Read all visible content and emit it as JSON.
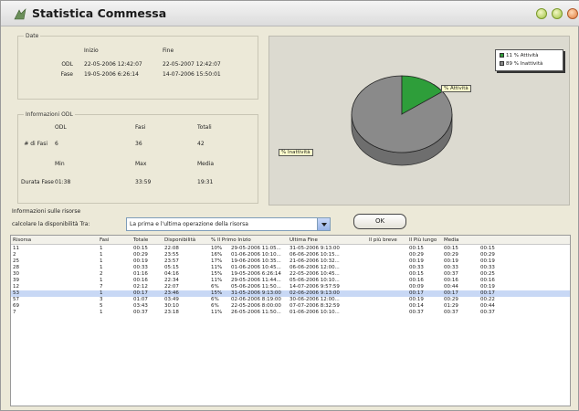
{
  "window": {
    "title": "Statistica Commessa"
  },
  "date_group": {
    "label": "Date",
    "col_start": "Inizio",
    "col_end": "Fine",
    "rows": [
      {
        "label": "ODL",
        "start": "22-05-2006 12:42:07",
        "end": "22-05-2007 12:42:07"
      },
      {
        "label": "Fase",
        "start": "19-05-2006 6:26:14",
        "end": "14-07-2006 15:50:01"
      }
    ]
  },
  "odl_group": {
    "label": "Informazioni ODL",
    "cols": [
      "ODL",
      "Fasi",
      "Totali"
    ],
    "count_row": {
      "label": "# di Fasi",
      "values": [
        "6",
        "36",
        "42"
      ]
    },
    "stat_cols": [
      "Min",
      "Max",
      "Media"
    ],
    "duration_row": {
      "label": "Durata Fase",
      "values": [
        "01:38",
        "33:59",
        "19:31"
      ]
    }
  },
  "chart": {
    "legend": [
      {
        "label": "11 % Attività",
        "color": "#2e9e3a"
      },
      {
        "label": "89 % Inattività",
        "color": "#8a8a8a"
      }
    ],
    "labels": {
      "active": "% Attività",
      "inactive": "% Inattività"
    },
    "colors": {
      "active": "#2e9e3a",
      "inactive": "#8a8a8a"
    }
  },
  "chart_data": {
    "type": "pie",
    "categories": [
      "Attività",
      "Inattività"
    ],
    "values": [
      11,
      89
    ]
  },
  "risorse": {
    "label": "Informazioni sulle risorse",
    "calc_label": "calcolare la disponibilità Tra:",
    "combo_value": "La prima e l'ultima operazione della risorsa",
    "ok_label": "OK"
  },
  "table": {
    "headers": [
      "Risorsa",
      "Fasi",
      "Totale",
      "Disponibilità",
      "% Il Primo Inizio",
      "Ultima Fine",
      "Il più breve",
      "Il Più lungo",
      "Media"
    ],
    "rows": [
      [
        "11",
        "1",
        "00:15",
        "22:08",
        "10%",
        "29-05-2006 11:05...",
        "31-05-2006 9:13:00",
        "00:15",
        "00:15",
        "00:15"
      ],
      [
        "2",
        "1",
        "00:29",
        "23:55",
        "16%",
        "01-06-2006 10:10...",
        "06-06-2006 10:15...",
        "00:29",
        "00:29",
        "00:29"
      ],
      [
        "25",
        "1",
        "00:19",
        "23:57",
        "17%",
        "19-06-2006 10:35...",
        "21-06-2006 10:32...",
        "00:19",
        "00:19",
        "00:19"
      ],
      [
        "28",
        "1",
        "00:33",
        "05:15",
        "11%",
        "01-06-2006 10:45...",
        "06-06-2006 12:00...",
        "00:33",
        "00:33",
        "00:33"
      ],
      [
        "30",
        "2",
        "01:16",
        "04:16",
        "15%",
        "19-05-2006 6:26:14",
        "22-05-2006 10:45...",
        "00:15",
        "00:37",
        "00:25"
      ],
      [
        "39",
        "1",
        "00:16",
        "22:34",
        "11%",
        "29-05-2006 11:44...",
        "05-06-2006 10:10...",
        "00:16",
        "00:16",
        "00:16"
      ],
      [
        "12",
        "7",
        "02:12",
        "22:07",
        "6%",
        "05-06-2006 11:50...",
        "14-07-2006 9:57:59",
        "00:09",
        "00:44",
        "00:19"
      ],
      [
        "53",
        "1",
        "00:17",
        "23:46",
        "15%",
        "31-05-2006 9:13:00",
        "02-06-2006 9:13:00",
        "00:17",
        "00:17",
        "00:17"
      ],
      [
        "57",
        "3",
        "01:07",
        "03:49",
        "6%",
        "02-06-2006 8:19:00",
        "30-06-2006 12:00...",
        "00:19",
        "00:29",
        "00:22"
      ],
      [
        "69",
        "5",
        "03:43",
        "30:10",
        "6%",
        "22-05-2006 8:00:00",
        "07-07-2006 8:32:59",
        "00:14",
        "01:29",
        "00:44"
      ],
      [
        "7",
        "1",
        "00:37",
        "23:18",
        "11%",
        "26-05-2006 11:50...",
        "01-06-2006 10:10...",
        "00:37",
        "00:37",
        "00:37"
      ]
    ]
  }
}
